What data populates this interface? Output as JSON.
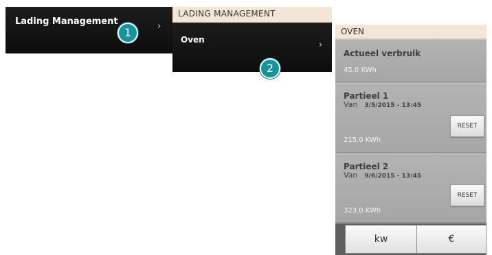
{
  "panel1": {
    "item_label": "Lading Management",
    "chevron": "›",
    "badge": "1"
  },
  "panel2": {
    "header": "LADING MANAGEMENT",
    "item_label": "Oven",
    "chevron": "›",
    "badge": "2"
  },
  "panel3": {
    "header": "OVEN",
    "actueel": {
      "title": "Actueel verbruik",
      "value": "45.0 KWh"
    },
    "partial1": {
      "title": "Partieel 1",
      "van_label": "Van",
      "date": "3/5/2015 - 13:45",
      "value": "215.0 KWh",
      "reset_label": "RESET"
    },
    "partial2": {
      "title": "Partieel 2",
      "van_label": "Van",
      "date": "9/6/2015 - 13:45",
      "value": "323.0 KWh",
      "reset_label": "RESET"
    },
    "units": {
      "kw_label": "kw",
      "euro_label": "€"
    }
  },
  "colors": {
    "badge": "#16939d",
    "header_bg": "#f3e6d7",
    "dark_panel": "#111111",
    "gray_panel": "#a9a9a9"
  }
}
